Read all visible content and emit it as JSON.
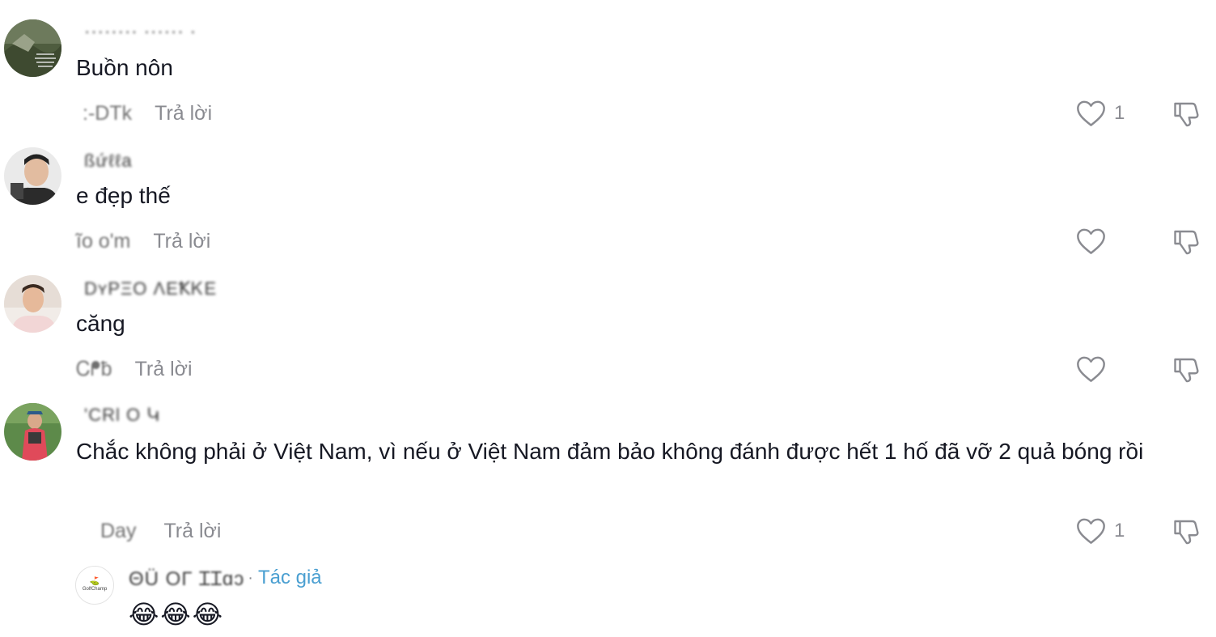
{
  "reply_label": "Trả lời",
  "comments": [
    {
      "username": "········  ······ ·",
      "text": "Buồn nôn",
      "date": ":-DTk",
      "likes": "1"
    },
    {
      "username": "ßứℓℓa",
      "text": "e đẹp thế",
      "date": "ĩo o'm",
      "likes": ""
    },
    {
      "username": "DʏPΞO  ɅEꝀᏦE",
      "text": "căng",
      "date": "Ꮯᖰƀ",
      "likes": ""
    },
    {
      "username": "'CRƖ O  Կ",
      "text": "Chắc không phải ở Việt Nam, vì nếu ở Việt Nam đảm bảo không đánh được hết 1 hố đã vỡ 2 quả bóng rồi",
      "date": "Day",
      "likes": "1"
    }
  ],
  "author_reply": {
    "username": "ΘÜ OΓ ꞮꞮɑɔ",
    "dot": "·",
    "badge": "Tác giả",
    "text": "😂😂😂",
    "avatar_text": "GolfChamp"
  },
  "colors": {
    "text": "#161823",
    "secondary": "#8a8b91",
    "author_badge": "#4a9fd1"
  },
  "icons": [
    "heart-outline-icon",
    "thumbs-down-icon"
  ]
}
